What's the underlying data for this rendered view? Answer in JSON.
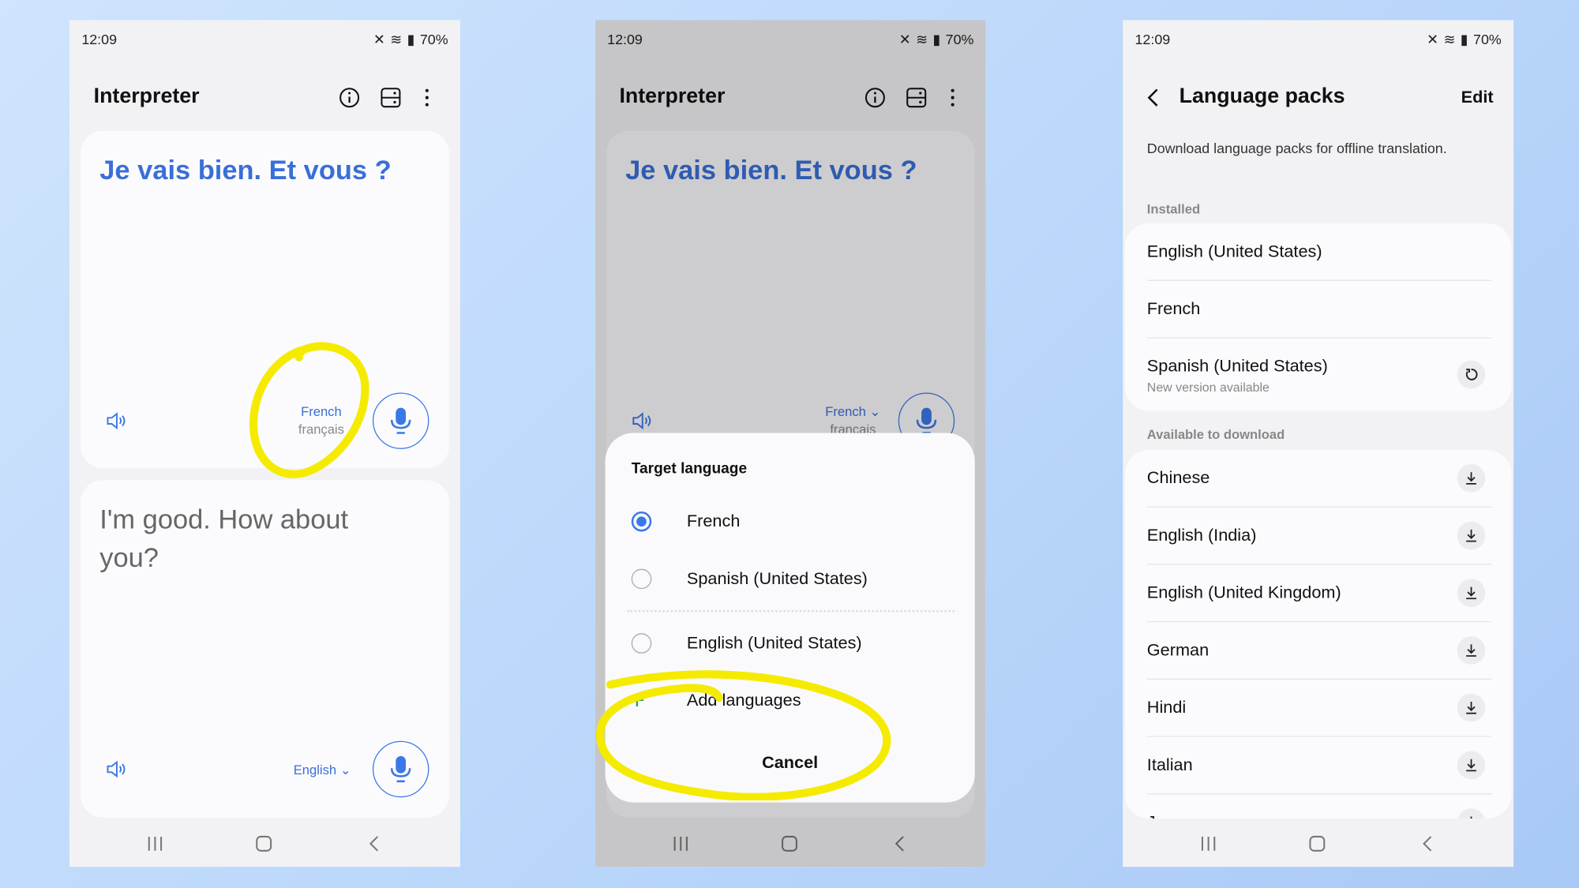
{
  "status": {
    "time": "12:09",
    "battery": "70%"
  },
  "interpreter": {
    "title": "Interpreter",
    "top_text": "Je vais bien. Et vous ?",
    "top_lang": "French",
    "top_lang_native": "français",
    "bottom_text": "I'm good. How about you?",
    "bottom_lang": "English"
  },
  "sheet": {
    "title": "Target language",
    "options": [
      {
        "label": "French",
        "selected": true
      },
      {
        "label": "Spanish (United States)",
        "selected": false
      },
      {
        "label": "English (United States)",
        "selected": false
      }
    ],
    "add_label": "Add languages",
    "cancel_label": "Cancel"
  },
  "packs": {
    "title": "Language packs",
    "edit_label": "Edit",
    "description": "Download language packs for offline translation.",
    "installed_header": "Installed",
    "installed": [
      {
        "name": "English (United States)"
      },
      {
        "name": "French"
      },
      {
        "name": "Spanish (United States)",
        "sub": "New version available",
        "icon": "update-icon"
      }
    ],
    "available_header": "Available to download",
    "available": [
      "Chinese",
      "English (India)",
      "English (United Kingdom)",
      "German",
      "Hindi",
      "Italian",
      "Japanese"
    ]
  },
  "colors": {
    "accent": "#3b78e7",
    "text_blue": "#3a6fd8",
    "highlight": "#f4eb00",
    "add_green": "#2aa060"
  }
}
